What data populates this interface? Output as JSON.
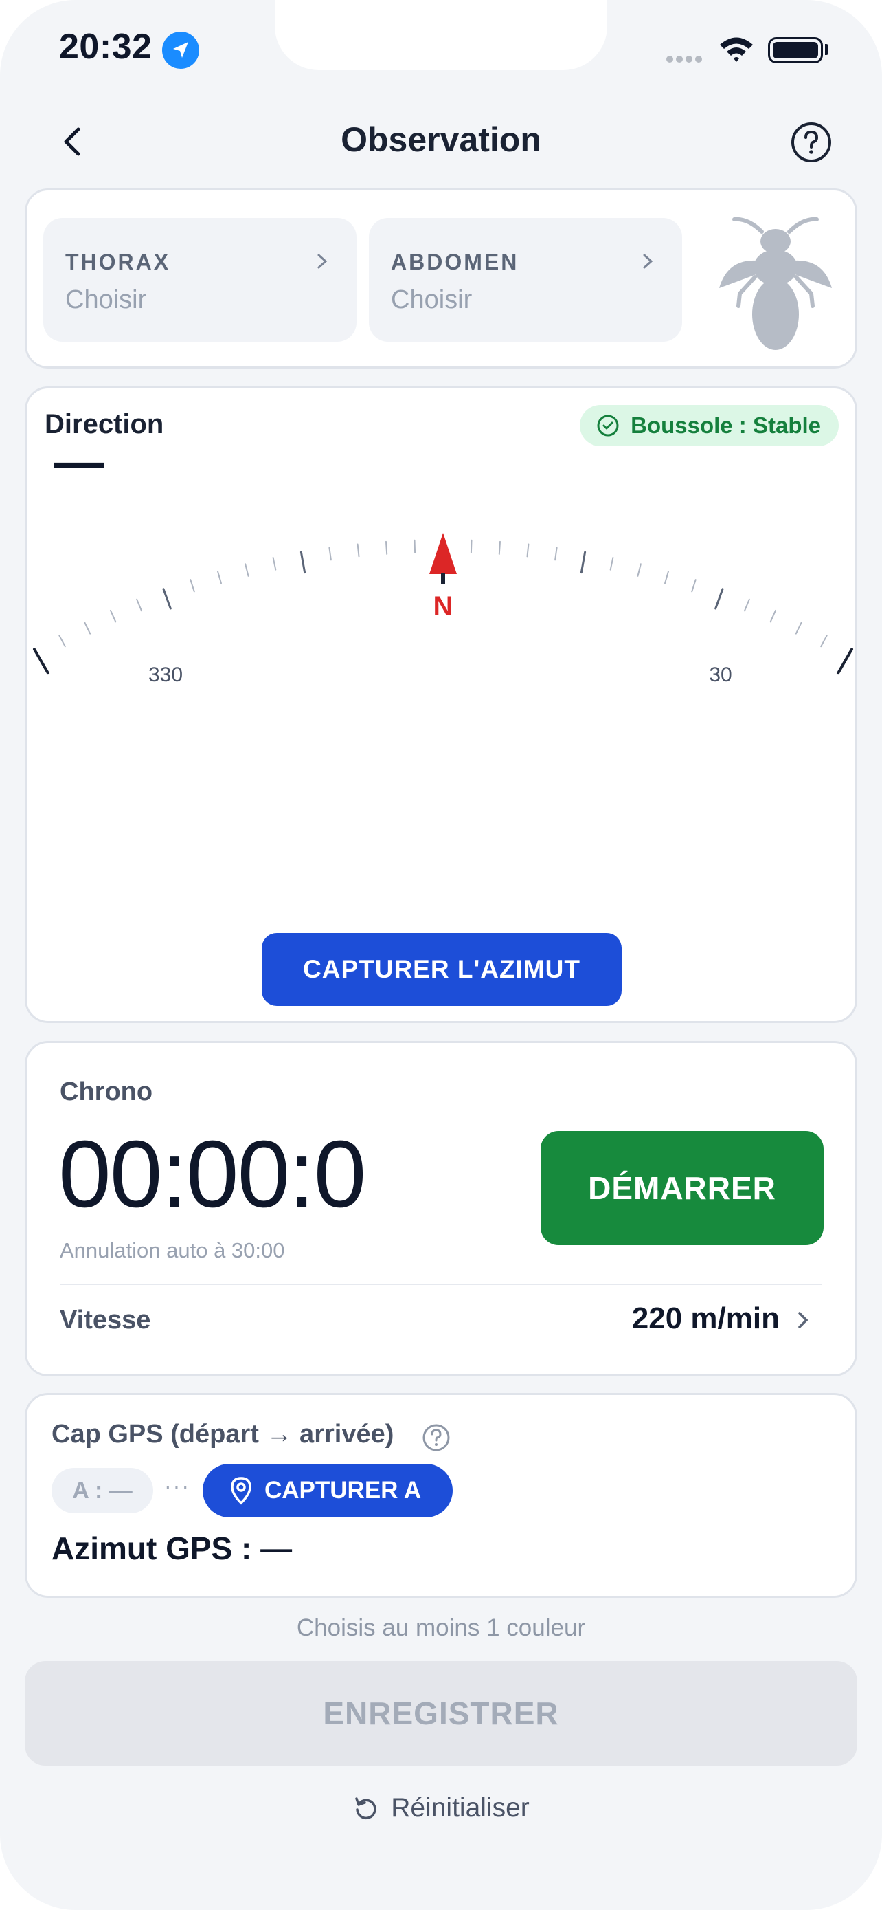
{
  "status_bar": {
    "time": "20:32"
  },
  "header": {
    "title": "Observation"
  },
  "parts": [
    {
      "label": "THORAX",
      "value": "Choisir"
    },
    {
      "label": "ABDOMEN",
      "value": "Choisir"
    }
  ],
  "direction": {
    "title": "Direction",
    "compass_status": "Boussole : Stable",
    "value": "—",
    "dial_labels": {
      "left": "330",
      "center": "N",
      "right": "30"
    },
    "capture_label": "CAPTURER L'AZIMUT",
    "colors": {
      "capture": "#1d4ed8",
      "north": "#dc2626",
      "badge": "#15803d"
    }
  },
  "chrono": {
    "label": "Chrono",
    "value": "00:00:0",
    "auto_cancel": "Annulation auto à 30:00",
    "start_label": "DÉMARRER",
    "speed_label": "Vitesse",
    "speed_value": "220 m/min",
    "colors": {
      "start": "#178a3d"
    }
  },
  "gps": {
    "title": "Cap GPS (départ → arrivée)",
    "point_a": "A : —",
    "dots": "···",
    "capture_a_label": "CAPTURER A",
    "azimuth": "Azimut GPS : —"
  },
  "footer": {
    "hint": "Choisis au moins 1 couleur",
    "save_label": "ENREGISTRER",
    "reset_label": "Réinitialiser"
  }
}
